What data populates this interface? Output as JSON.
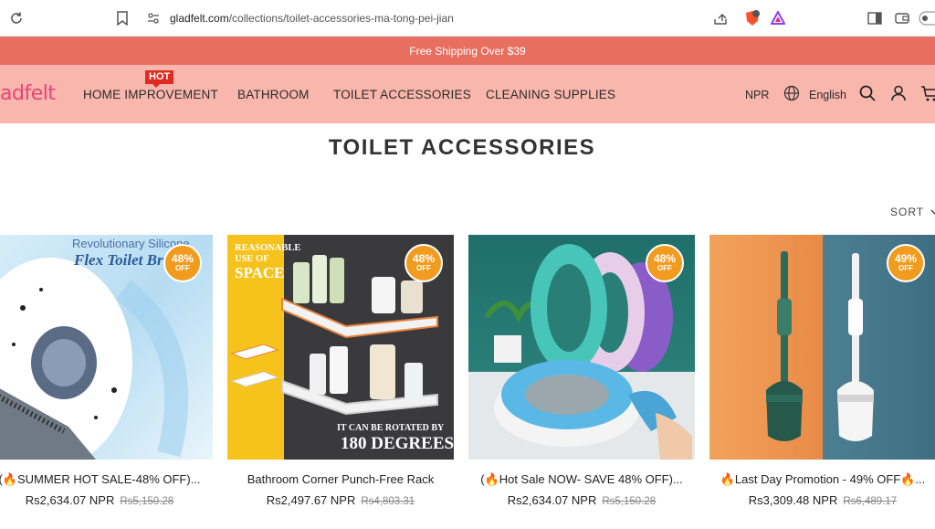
{
  "browser": {
    "url_host": "gladfelt.com",
    "url_path": "/collections/toilet-accessories-ma-tong-pei-jian"
  },
  "promo": {
    "text": "Free Shipping Over $39"
  },
  "nav": {
    "logo": "adfelt",
    "links": [
      "HOME IMPROVEMENT",
      "BATHROOM",
      "TOILET ACCESSORIES",
      "CLEANING SUPPLIES"
    ],
    "hot_badge": "HOT",
    "currency": "NPR",
    "language": "English"
  },
  "page": {
    "title": "TOILET ACCESSORIES",
    "sort_label": "SORT"
  },
  "products": [
    {
      "title": "(🔥SUMMER HOT SALE-48% OFF)...",
      "price": "Rs2,634.07 NPR",
      "old_price": "Rs5,150.28",
      "discount": "48%",
      "off": "OFF",
      "img_text1": "Revolutionary Silicone",
      "img_text2": "Flex Toilet Brush"
    },
    {
      "title": "Bathroom Corner Punch-Free Rack",
      "price": "Rs2,497.67 NPR",
      "old_price": "Rs4,803.31",
      "discount": "48%",
      "off": "OFF",
      "img_text1": "REASONABLE",
      "img_text2": "USE OF",
      "img_text3": "SPACE",
      "img_text4": "IT CAN BE ROTATED BY",
      "img_text5": "180 DEGREES"
    },
    {
      "title": "(🔥Hot Sale NOW- SAVE 48% OFF)...",
      "price": "Rs2,634.07 NPR",
      "old_price": "Rs5,150.28",
      "discount": "48%",
      "off": "OFF"
    },
    {
      "title": "🔥Last Day Promotion - 49% OFF🔥...",
      "price": "Rs3,309.48 NPR",
      "old_price": "Rs6,489.17",
      "discount": "49%",
      "off": "OFF"
    }
  ],
  "colors": {
    "promo_bg": "#e86f5f",
    "nav_bg": "#f9b6ac",
    "badge": "#f29c1f",
    "logo": "#e8447a"
  }
}
